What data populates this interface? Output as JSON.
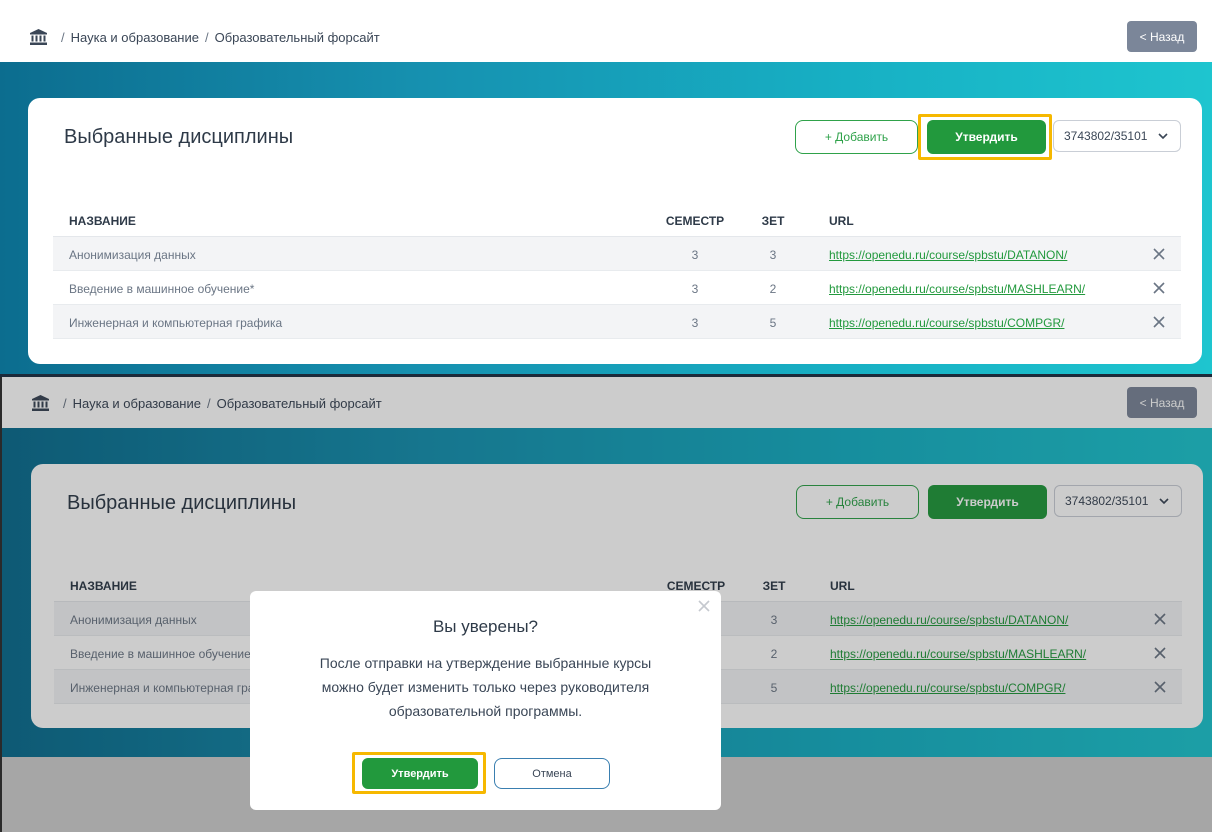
{
  "breadcrumb": {
    "home_icon": "home-bank-icon",
    "items": [
      "Наука и образование",
      "Образовательный форсайт"
    ]
  },
  "back_button": "< Назад",
  "card": {
    "title": "Выбранные дисциплины",
    "add_label": "+ Добавить",
    "approve_label": "Утвердить",
    "program_select": "3743802/35101"
  },
  "table": {
    "headers": [
      "НАЗВАНИЕ",
      "СЕМЕСТР",
      "ЗЕТ",
      "URL"
    ],
    "rows": [
      {
        "name": "Анонимизация данных",
        "semester": "3",
        "zet": "3",
        "url": "https://openedu.ru/course/spbstu/DATANON/"
      },
      {
        "name": "Введение в машинное обучение*",
        "semester": "3",
        "zet": "2",
        "url": "https://openedu.ru/course/spbstu/MASHLEARN/"
      },
      {
        "name": "Инженерная и компьютерная графика",
        "semester": "3",
        "zet": "5",
        "url": "https://openedu.ru/course/spbstu/COMPGR/"
      }
    ]
  },
  "dialog": {
    "title": "Вы уверены?",
    "line1": "После отправки на утверждение выбранные курсы",
    "line2": "можно будет изменить только через руководителя",
    "line3": "образовательной программы.",
    "confirm_label": "Утвердить",
    "cancel_label": "Отмена"
  },
  "colors": {
    "accent_green": "#22993d",
    "highlight": "#f6b800",
    "back_button": "#7b8699"
  }
}
